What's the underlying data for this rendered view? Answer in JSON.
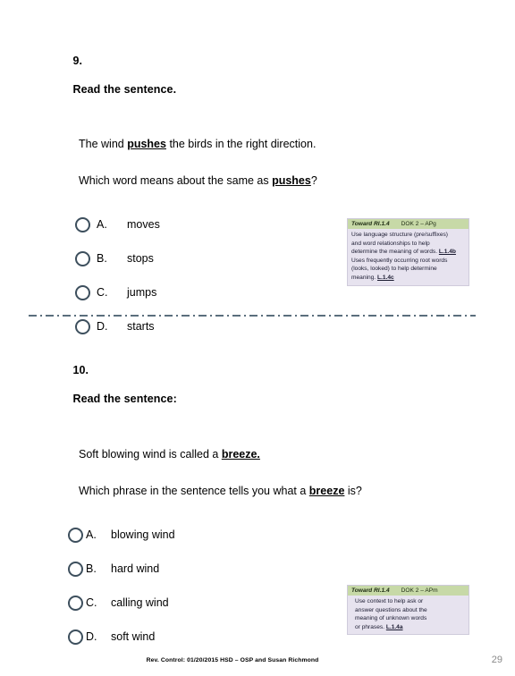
{
  "document": {
    "page_number": "29",
    "footer_note": "Rev. Control: 01/20/2015 HSD – OSP and Susan Richmond"
  },
  "questions": [
    {
      "number": "9.",
      "prompt": "Read the sentence.",
      "sentence_before": "The wind ",
      "sentence_keyword": "pushes",
      "sentence_after": " the birds in the right direction.",
      "question_before": "Which word means about the same as ",
      "question_keyword": "pushes",
      "question_after": "?",
      "choices": [
        {
          "letter": "A.",
          "text": "moves"
        },
        {
          "letter": "B.",
          "text": "stops"
        },
        {
          "letter": "C.",
          "text": "jumps"
        },
        {
          "letter": "D.",
          "text": "starts"
        }
      ]
    },
    {
      "number": "10.",
      "prompt": "Read the sentence:",
      "sentence_before": "Soft blowing wind is called a ",
      "sentence_keyword": "breeze.",
      "sentence_after": "",
      "question_before": "Which phrase in the sentence tells you what a ",
      "question_keyword": "breeze",
      "question_after": " is?",
      "choices": [
        {
          "letter": "A.",
          "text": "blowing wind"
        },
        {
          "letter": "B.",
          "text": "hard wind"
        },
        {
          "letter": "C.",
          "text": "calling wind"
        },
        {
          "letter": "D.",
          "text": "soft wind"
        }
      ]
    }
  ],
  "standards": [
    {
      "code": "Toward RI.1.4",
      "dok": "DOK 2 – APg",
      "line1": "Use language structure (pre/suffixes)",
      "line2": "and word relationships to help",
      "line3": "determine the meaning of words. ",
      "cc1": "L.1.4b",
      "line4": "Uses frequently occurring root words",
      "line5": "(looks, looked) to help determine",
      "line6": "meaning. ",
      "cc2": "L.1.4c"
    },
    {
      "code": "Toward RI.1.4",
      "dok": "DOK 2 – APm",
      "line1": "Use context to help ask or",
      "line2": "answer questions about the",
      "line3": "meaning of unknown words",
      "line4": "or phrases. ",
      "cc1": "L.1.4a"
    }
  ],
  "colors": {
    "bubble_stroke": "#3d4f5d",
    "divider": "#5b6e7d",
    "standard_header_bg": "#c7d9a7",
    "standard_body_bg": "#e7e3ef",
    "page_number": "#8a8a8a"
  }
}
